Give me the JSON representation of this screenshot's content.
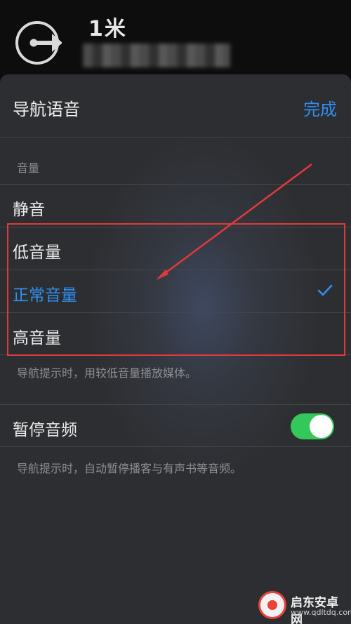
{
  "banner": {
    "distance": "1米",
    "turn_icon": "exit-right-arrow-icon"
  },
  "sheet": {
    "title": "导航语音",
    "done_label": "完成",
    "volume_section_label": "音量",
    "options": [
      {
        "label": "静音",
        "selected": false
      },
      {
        "label": "低音量",
        "selected": false
      },
      {
        "label": "正常音量",
        "selected": true
      },
      {
        "label": "高音量",
        "selected": false
      }
    ],
    "volume_note": "导航提示时，用较低音量播放媒体。",
    "pause_audio_label": "暂停音频",
    "pause_audio_on": true,
    "pause_audio_note": "导航提示时，自动暂停播客与有声书等音频。"
  },
  "colors": {
    "accent": "#2f8ff0",
    "toggle_on": "#34c759",
    "annotation": "#e03a3a"
  },
  "watermark": {
    "name": "启东安卓网",
    "url": "www.qdltdq.com"
  }
}
